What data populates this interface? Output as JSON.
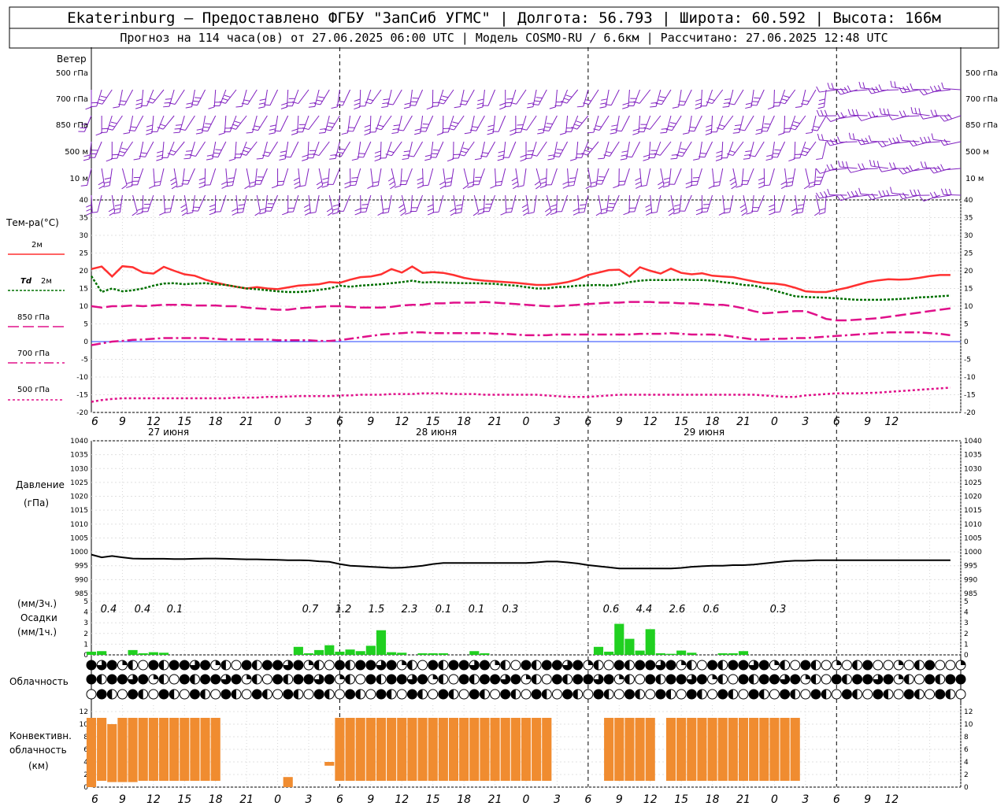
{
  "header": {
    "line1": "Ekaterinburg – Предоставлено ФГБУ \"ЗапСиб УГМС\" | Долгота: 56.793 | Широта: 60.592 | Высота: 166м",
    "line2": "Прогноз на 114 часа(ов) от 27.06.2025 06:00 UTC  | Модель COSMO-RU / 6.6км | Рассчитано: 27.06.2025 12:48 UTC"
  },
  "labels": {
    "wind": "Ветер",
    "temp": "Тем-ра(°C)",
    "t2m": "2м",
    "td_a": "Td",
    "td_b": "2м",
    "l850": "850 гПа",
    "l700": "700 гПа",
    "l500": "500 гПа",
    "pressure_a": "Давление",
    "pressure_b": "(гПа)",
    "precip_a": "(мм/3ч.)",
    "precip_b": "Осадки",
    "precip_c": "(мм/1ч.)",
    "clouds": "Облачность",
    "conv_a": "Конвективн.",
    "conv_b": "облачность",
    "conv_c": "(км)"
  },
  "wind_levels": [
    "500 гПа",
    "700 гПа",
    "850 гПа",
    "500 м",
    "10  м"
  ],
  "time_ticks": [
    "6",
    "9",
    "12",
    "15",
    "18",
    "21",
    "0",
    "3",
    "6",
    "9",
    "12",
    "15",
    "18",
    "21",
    "0",
    "3",
    "6",
    "9",
    "12",
    "15",
    "18",
    "21",
    "0",
    "3",
    "6",
    "9",
    "12"
  ],
  "day_labels": [
    "27 июня",
    "28 июня",
    "29 июня"
  ],
  "colors": {
    "wind": "#8020c0",
    "t2m": "#ff3030",
    "td": "#007000",
    "level": "#e0108a",
    "pressure": "#000000",
    "precip": "#20d020",
    "convective": "#f08c30"
  },
  "chart_data": [
    {
      "type": "line",
      "title": "Тем-ра(°C)",
      "x": [
        "27 06",
        "27 07",
        "27 08",
        "27 09",
        "27 10",
        "27 11",
        "27 12",
        "27 13",
        "27 14",
        "27 15",
        "27 16",
        "27 17",
        "27 18",
        "27 19",
        "27 20",
        "27 21",
        "27 22",
        "27 23",
        "28 00",
        "28 01",
        "28 02",
        "28 03",
        "28 04",
        "28 05",
        "28 06",
        "28 07",
        "28 08",
        "28 09",
        "28 10",
        "28 11",
        "28 12",
        "28 13",
        "28 14",
        "28 15",
        "28 16",
        "28 17",
        "28 18",
        "28 19",
        "28 20",
        "28 21",
        "28 22",
        "28 23",
        "29 00",
        "29 01",
        "29 02",
        "29 03",
        "29 04",
        "29 05",
        "29 06",
        "29 07",
        "29 08",
        "29 09",
        "29 10",
        "29 11",
        "29 12",
        "29 13",
        "29 14",
        "29 15",
        "29 16",
        "29 17",
        "29 18",
        "29 19",
        "29 20",
        "29 21",
        "29 22",
        "29 23",
        "30 00",
        "30 01",
        "30 02",
        "30 03",
        "30 04",
        "30 05",
        "30 06",
        "30 07",
        "30 08",
        "30 09",
        "30 10",
        "30 11",
        "30 12"
      ],
      "ylim": [
        -20,
        40
      ],
      "series": [
        {
          "name": "2м",
          "values": [
            20.5,
            21.2,
            18.4,
            21.3,
            21.0,
            19.5,
            19.2,
            21.1,
            20.0,
            19.0,
            18.6,
            17.5,
            16.7,
            16.0,
            15.5,
            15.0,
            15.4,
            15.0,
            14.8,
            15.3,
            15.8,
            16.0,
            16.2,
            16.8,
            16.6,
            17.5,
            18.2,
            18.4,
            19.0,
            20.5,
            19.5,
            21.2,
            19.4,
            19.6,
            19.4,
            18.8,
            18.0,
            17.5,
            17.2,
            17.0,
            16.8,
            16.6,
            16.3,
            16.0,
            16.0,
            16.3,
            16.8,
            17.6,
            18.8,
            19.5,
            20.2,
            20.3,
            18.4,
            21.0,
            20.0,
            19.2,
            20.6,
            19.4,
            19.0,
            19.3,
            18.6,
            18.4,
            18.2,
            17.6,
            17.0,
            16.5,
            16.4,
            16.0,
            15.2,
            14.2,
            14.0,
            14.0,
            14.6,
            15.2,
            16.0,
            16.8,
            17.3,
            17.6,
            17.5,
            17.6,
            18.0,
            18.5,
            18.8,
            18.8
          ]
        },
        {
          "name": "Td 2м",
          "values": [
            18.5,
            14.0,
            15.0,
            14.2,
            14.5,
            15.0,
            15.8,
            16.4,
            16.5,
            16.2,
            16.4,
            16.5,
            16.2,
            16.0,
            15.5,
            15.0,
            14.8,
            14.5,
            14.2,
            14.0,
            14.0,
            14.2,
            14.6,
            15.0,
            15.8,
            15.5,
            15.8,
            16.0,
            16.2,
            16.5,
            16.8,
            17.2,
            16.7,
            16.8,
            16.7,
            16.6,
            16.5,
            16.5,
            16.4,
            16.3,
            16.0,
            15.8,
            15.4,
            15.0,
            15.0,
            15.4,
            15.5,
            15.8,
            15.9,
            16.0,
            15.8,
            16.2,
            16.8,
            17.2,
            17.4,
            17.4,
            17.4,
            17.5,
            17.4,
            17.4,
            17.2,
            16.8,
            16.5,
            16.0,
            15.8,
            15.2,
            14.4,
            13.6,
            12.8,
            12.6,
            12.5,
            12.4,
            12.2,
            12.0,
            11.8,
            11.8,
            11.8,
            11.9,
            12.0,
            12.2,
            12.5,
            12.6,
            12.8,
            13.0
          ]
        },
        {
          "name": "850 гПа",
          "values": [
            10.0,
            9.6,
            10.0,
            10.0,
            10.2,
            10.0,
            10.2,
            10.4,
            10.4,
            10.4,
            10.2,
            10.2,
            10.2,
            10.0,
            10.0,
            9.6,
            9.4,
            9.2,
            9.0,
            9.0,
            9.4,
            9.6,
            9.8,
            10.0,
            10.0,
            9.8,
            9.6,
            9.6,
            9.6,
            9.8,
            10.2,
            10.4,
            10.4,
            10.8,
            10.8,
            11.0,
            11.0,
            11.0,
            11.2,
            11.0,
            10.8,
            10.6,
            10.4,
            10.2,
            10.0,
            10.0,
            10.2,
            10.4,
            10.6,
            10.8,
            11.0,
            11.0,
            11.2,
            11.2,
            11.2,
            11.0,
            11.0,
            10.8,
            10.8,
            10.6,
            10.4,
            10.4,
            10.0,
            9.4,
            8.6,
            8.0,
            8.2,
            8.4,
            8.6,
            8.6,
            7.6,
            6.4,
            6.0,
            6.0,
            6.2,
            6.4,
            6.6,
            7.0,
            7.4,
            7.8,
            8.2,
            8.6,
            9.0,
            9.4
          ]
        },
        {
          "name": "700 гПа",
          "values": [
            -1.0,
            -0.5,
            0.0,
            0.2,
            0.5,
            0.6,
            0.8,
            1.0,
            1.0,
            1.0,
            1.0,
            1.0,
            0.8,
            0.6,
            0.6,
            0.6,
            0.6,
            0.6,
            0.4,
            0.4,
            0.4,
            0.4,
            0.2,
            0.2,
            0.4,
            0.8,
            1.2,
            1.6,
            2.0,
            2.2,
            2.4,
            2.6,
            2.6,
            2.4,
            2.4,
            2.4,
            2.4,
            2.4,
            2.4,
            2.2,
            2.2,
            2.0,
            1.8,
            1.8,
            1.8,
            2.0,
            2.0,
            2.0,
            2.0,
            2.0,
            2.0,
            2.0,
            2.0,
            2.2,
            2.2,
            2.2,
            2.4,
            2.2,
            2.0,
            2.0,
            2.0,
            1.8,
            1.4,
            1.0,
            0.6,
            0.6,
            0.8,
            0.8,
            1.0,
            1.0,
            1.2,
            1.4,
            1.6,
            1.8,
            2.0,
            2.2,
            2.4,
            2.6,
            2.6,
            2.6,
            2.6,
            2.4,
            2.2,
            1.8
          ]
        },
        {
          "name": "500 гПа",
          "values": [
            -17.0,
            -16.5,
            -16.2,
            -16.0,
            -16.0,
            -16.0,
            -16.0,
            -16.0,
            -16.0,
            -16.0,
            -16.0,
            -16.0,
            -16.0,
            -16.0,
            -15.8,
            -15.8,
            -15.8,
            -15.6,
            -15.6,
            -15.5,
            -15.4,
            -15.4,
            -15.4,
            -15.4,
            -15.2,
            -15.2,
            -15.0,
            -15.0,
            -15.0,
            -14.8,
            -14.8,
            -14.8,
            -14.6,
            -14.6,
            -14.6,
            -14.8,
            -14.8,
            -14.8,
            -15.0,
            -15.0,
            -15.0,
            -15.0,
            -15.0,
            -15.0,
            -15.2,
            -15.4,
            -15.6,
            -15.6,
            -15.6,
            -15.4,
            -15.2,
            -15.0,
            -15.0,
            -15.0,
            -15.0,
            -15.0,
            -15.0,
            -15.0,
            -15.0,
            -15.0,
            -15.0,
            -15.0,
            -15.0,
            -15.0,
            -15.0,
            -15.2,
            -15.4,
            -15.6,
            -15.6,
            -15.2,
            -15.0,
            -14.8,
            -14.6,
            -14.6,
            -14.6,
            -14.5,
            -14.4,
            -14.2,
            -14.0,
            -13.8,
            -13.6,
            -13.4,
            -13.2,
            -13.0
          ]
        }
      ]
    },
    {
      "type": "line",
      "title": "Давление",
      "ylabel": "(гПа)",
      "ylim": [
        985,
        1040
      ],
      "series": [
        {
          "name": "Давление",
          "values": [
            999.0,
            998.0,
            998.5,
            998.0,
            997.6,
            997.5,
            997.5,
            997.5,
            997.4,
            997.4,
            997.5,
            997.6,
            997.6,
            997.5,
            997.4,
            997.3,
            997.3,
            997.2,
            997.1,
            997.0,
            997.0,
            996.9,
            996.6,
            996.4,
            995.6,
            995.0,
            994.8,
            994.6,
            994.4,
            994.2,
            994.3,
            994.6,
            995.0,
            995.6,
            996.0,
            996.0,
            996.0,
            996.0,
            996.0,
            996.0,
            996.0,
            996.0,
            996.0,
            996.2,
            996.5,
            996.5,
            996.2,
            995.8,
            995.2,
            994.8,
            994.4,
            994.0,
            994.0,
            994.0,
            994.0,
            994.0,
            994.0,
            994.2,
            994.6,
            994.8,
            995.0,
            995.0,
            995.2,
            995.2,
            995.4,
            995.8,
            996.2,
            996.6,
            996.8,
            996.8,
            997.0,
            997.0,
            997.0,
            997.0,
            997.0,
            997.0,
            997.0,
            997.0,
            997.0,
            997.0,
            997.0,
            997.0,
            997.0,
            997.0
          ]
        }
      ]
    },
    {
      "type": "bar",
      "title": "Осадки",
      "ylim": [
        0,
        5
      ],
      "series": [
        {
          "name": "мм/1ч",
          "values": [
            0.3,
            0.35,
            0.0,
            0.0,
            0.45,
            0.15,
            0.25,
            0.2,
            0.0,
            0.0,
            0.0,
            0.0,
            0.0,
            0.0,
            0.0,
            0.0,
            0.0,
            0.0,
            0.0,
            0.0,
            0.75,
            0.15,
            0.45,
            0.9,
            0.3,
            0.5,
            0.35,
            0.85,
            2.3,
            0.25,
            0.2,
            0.0,
            0.15,
            0.15,
            0.15,
            0.0,
            0.0,
            0.35,
            0.15,
            0.0,
            0.0,
            0.0,
            0.0,
            0.0,
            0.0,
            0.0,
            0.0,
            0.0,
            0.0,
            0.75,
            0.3,
            2.9,
            1.5,
            0.4,
            2.4,
            0.15,
            0.1,
            0.4,
            0.2,
            0.0,
            0.0,
            0.15,
            0.15,
            0.35,
            0.0,
            0.0,
            0.0,
            0.0,
            0.0,
            0.0,
            0.0,
            0.0,
            0.0,
            0.0,
            0.0,
            0.0,
            0.0,
            0.0,
            0.0,
            0.0,
            0.0,
            0.0,
            0.0,
            0.0
          ]
        },
        {
          "name": "мм/3ч",
          "labels": [
            "0.4",
            "0.4",
            "0.1",
            "0.7",
            "1.2",
            "1.5",
            "2.3",
            "0.1",
            "0.1",
            "0.3",
            "0.6",
            "4.4",
            "2.6",
            "0.6",
            "0.3"
          ]
        }
      ]
    },
    {
      "type": "bar",
      "title": "Конвективн. облачность",
      "ylabel": "(км)",
      "ylim": [
        0,
        13
      ],
      "series": [
        {
          "name": "низ",
          "values": [
            0,
            1.0,
            0.8,
            0.8,
            0.8,
            1.0,
            1.0,
            1.0,
            1.0,
            1.0,
            1.0,
            1.0,
            1.0,
            0,
            0,
            0,
            0,
            0,
            0,
            0,
            0,
            0,
            0,
            3.4,
            1.0,
            1.0,
            1.0,
            1.0,
            1.0,
            1.0,
            1.0,
            1.0,
            1.0,
            1.0,
            1.0,
            1.0,
            1.0,
            1.0,
            1.0,
            1.0,
            1.0,
            1.0,
            1.0,
            1.0,
            1.0,
            0,
            0,
            0,
            0,
            0,
            1.0,
            1.0,
            1.0,
            1.0,
            1.0,
            0,
            1.0,
            1.0,
            1.0,
            1.0,
            1.0,
            1.0,
            1.0,
            1.0,
            1.0,
            1.0,
            1.0,
            1.0,
            1.0,
            0,
            0,
            0,
            0,
            0,
            0,
            0,
            0,
            0,
            0,
            0,
            0,
            0,
            0,
            0
          ]
        },
        {
          "name": "верх",
          "values": [
            11.0,
            11.0,
            10.0,
            11.0,
            11.0,
            11.0,
            11.0,
            11.0,
            11.0,
            11.0,
            11.0,
            11.0,
            11.0,
            0,
            0,
            0,
            0,
            0,
            0,
            1.6,
            0,
            0,
            0,
            4.0,
            11.0,
            11.0,
            11.0,
            11.0,
            11.0,
            11.0,
            11.0,
            11.0,
            11.0,
            11.0,
            11.0,
            11.0,
            11.0,
            11.0,
            11.0,
            11.0,
            11.0,
            11.0,
            11.0,
            11.0,
            11.0,
            0,
            0,
            0,
            0,
            0,
            11.0,
            11.0,
            11.0,
            11.0,
            11.0,
            0,
            11.0,
            11.0,
            11.0,
            11.0,
            11.0,
            11.0,
            11.0,
            11.0,
            11.0,
            11.0,
            11.0,
            11.0,
            11.0,
            0,
            0,
            0,
            0,
            0,
            0,
            0,
            0,
            0,
            0,
            0,
            0,
            0,
            0,
            0
          ]
        }
      ]
    }
  ]
}
